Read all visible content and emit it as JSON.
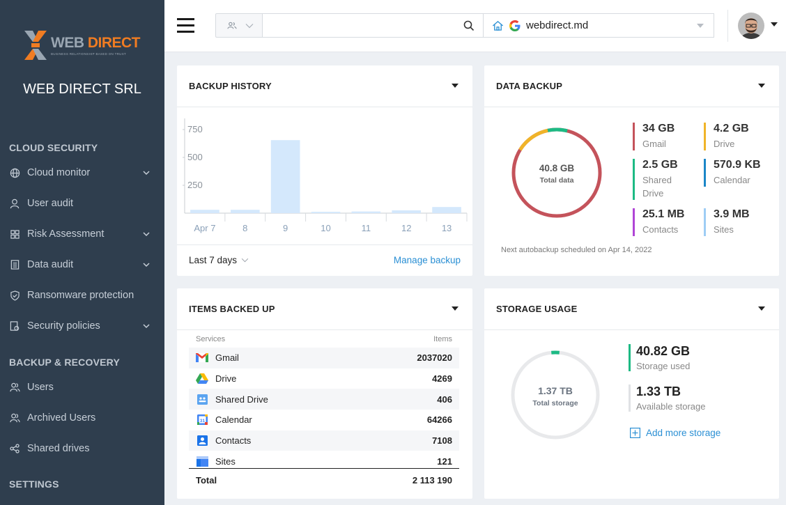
{
  "brand": {
    "logo_word1": "WEB",
    "logo_word2": "DIRECT",
    "logo_tagline": "BUSINESS RELATIONSHIP BASED ON TRUST",
    "company_name": "WEB DIRECT SRL",
    "accent_color": "#f07c22",
    "sidebar_color": "#2f3e4e"
  },
  "sidebar": {
    "sections": [
      {
        "title": "CLOUD SECURITY",
        "items": [
          {
            "label": "Cloud monitor",
            "icon": "globe-icon",
            "expandable": true
          },
          {
            "label": "User audit",
            "icon": "user-icon",
            "expandable": false
          },
          {
            "label": "Risk Assessment",
            "icon": "grid-icon",
            "expandable": true
          },
          {
            "label": "Data audit",
            "icon": "document-icon",
            "expandable": true
          },
          {
            "label": "Ransomware protection",
            "icon": "shield-icon",
            "expandable": false
          },
          {
            "label": "Security policies",
            "icon": "policy-icon",
            "expandable": true
          }
        ]
      },
      {
        "title": "BACKUP & RECOVERY",
        "items": [
          {
            "label": "Users",
            "icon": "users-icon",
            "expandable": false
          },
          {
            "label": "Archived Users",
            "icon": "archived-users-icon",
            "expandable": false
          },
          {
            "label": "Shared drives",
            "icon": "share-icon",
            "expandable": false
          }
        ]
      },
      {
        "title": "SETTINGS",
        "items": []
      }
    ]
  },
  "topbar": {
    "search_value": "",
    "domain": "webdirect.md"
  },
  "backup_history": {
    "title": "BACKUP HISTORY",
    "period": "Last 7 days",
    "manage_link": "Manage backup"
  },
  "chart_data": {
    "type": "bar",
    "categories": [
      "Apr 7",
      "8",
      "9",
      "10",
      "11",
      "12",
      "13"
    ],
    "values": [
      30,
      30,
      655,
      12,
      15,
      25,
      55
    ],
    "ylim": [
      0,
      850
    ],
    "yticks": [
      250,
      500,
      750
    ],
    "bar_color": "#d4e8fc",
    "grid": false
  },
  "data_backup": {
    "title": "DATA BACKUP",
    "total_value": "40.8 GB",
    "total_label": "Total data",
    "items": [
      {
        "value": "34 GB",
        "label": "Gmail",
        "color": "#c4535b"
      },
      {
        "value": "4.2 GB",
        "label": "Drive",
        "color": "#f0b429"
      },
      {
        "value": "2.5 GB",
        "label": "Shared Drive",
        "color": "#1dba84"
      },
      {
        "value": "570.9 KB",
        "label": "Calendar",
        "color": "#1b86c7"
      },
      {
        "value": "25.1 MB",
        "label": "Contacts",
        "color": "#b045d6"
      },
      {
        "value": "3.9 MB",
        "label": "Sites",
        "color": "#9ecdf5"
      }
    ],
    "schedule_note": "Next autobackup scheduled on Apr 14, 2022"
  },
  "items_backed_up": {
    "title": "ITEMS BACKED UP",
    "col_services": "Services",
    "col_items": "Items",
    "rows": [
      {
        "service": "Gmail",
        "count": "2037020",
        "icon": "gmail-icon"
      },
      {
        "service": "Drive",
        "count": "4269",
        "icon": "drive-icon"
      },
      {
        "service": "Shared Drive",
        "count": "406",
        "icon": "shared-drive-icon"
      },
      {
        "service": "Calendar",
        "count": "64266",
        "icon": "calendar-icon"
      },
      {
        "service": "Contacts",
        "count": "7108",
        "icon": "contacts-icon"
      },
      {
        "service": "Sites",
        "count": "121",
        "icon": "sites-icon"
      }
    ],
    "total_label": "Total",
    "total_value": "2 113 190"
  },
  "storage_usage": {
    "title": "STORAGE USAGE",
    "total_value": "1.37 TB",
    "total_label": "Total storage",
    "used_value": "40.82 GB",
    "used_label": "Storage used",
    "used_fraction": 0.03,
    "used_color": "#1dba84",
    "available_value": "1.33 TB",
    "available_label": "Available storage",
    "add_label": "Add more storage"
  }
}
